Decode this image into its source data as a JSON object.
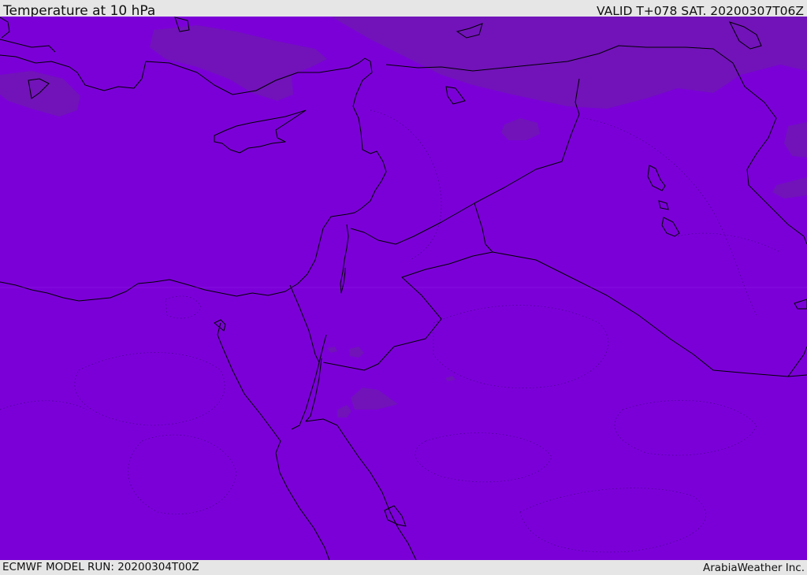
{
  "header": {
    "title": "Temperature at 10 hPa",
    "valid_time": "VALID T+078 SAT. 20200307T06Z"
  },
  "footer": {
    "model_run": "ECMWF MODEL RUN: 20200304T00Z",
    "credit": "ArabiaWeather Inc."
  },
  "colors": {
    "field": "#7b00d8",
    "cooler_patch": "#7113b9",
    "coastline": "#000000",
    "frame": "#e6e6e6"
  }
}
